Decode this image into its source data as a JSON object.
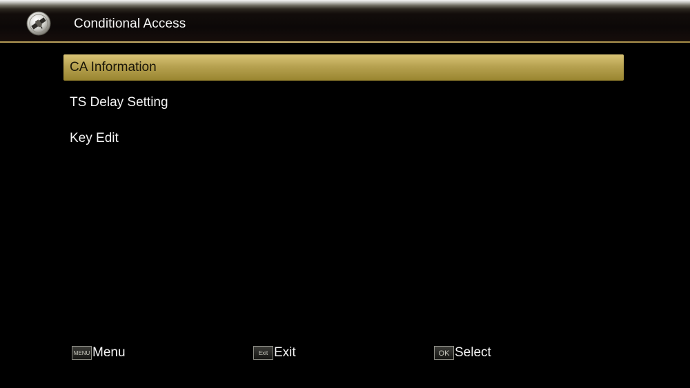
{
  "header": {
    "title": "Conditional Access",
    "icon": "satellite-icon"
  },
  "menu": {
    "items": [
      {
        "label": "CA Information",
        "selected": true
      },
      {
        "label": "TS Delay Setting",
        "selected": false
      },
      {
        "label": "Key Edit",
        "selected": false
      }
    ]
  },
  "footer": {
    "menu": {
      "key": "MENU",
      "label": "Menu"
    },
    "exit": {
      "key": "Exit",
      "label": "Exit"
    },
    "select": {
      "key": "OK",
      "label": "Select"
    }
  },
  "colors": {
    "accent": "#c3ad5e",
    "background": "#000000",
    "text": "#f4f4f4"
  }
}
